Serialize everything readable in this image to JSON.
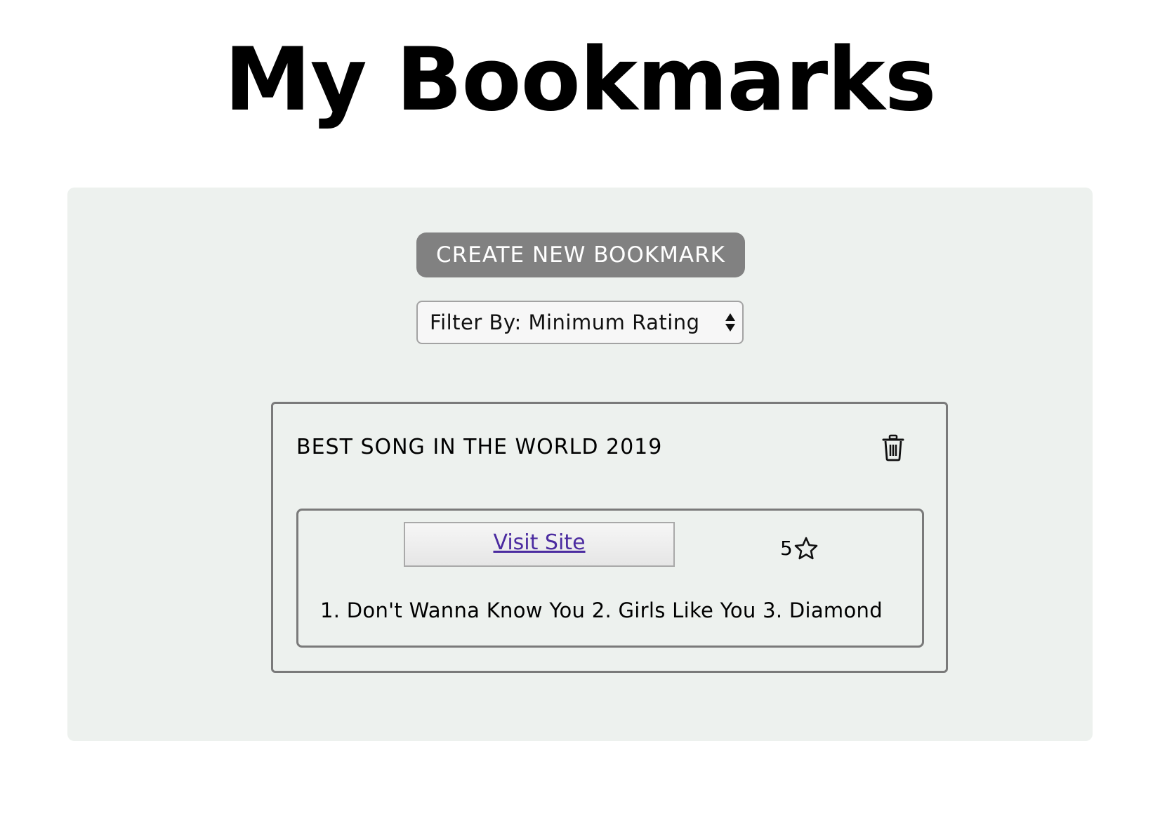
{
  "page": {
    "title": "My Bookmarks"
  },
  "toolbar": {
    "create_label": "CREATE NEW BOOKMARK",
    "filter_label": "Filter By: Minimum Rating"
  },
  "bookmarks": [
    {
      "title": "BEST SONG IN THE WORLD 2019",
      "link_label": "Visit Site",
      "rating": "5",
      "description": "1. Don't Wanna Know You 2. Girls Like You 3. Diamond",
      "icons": {
        "delete": "trash-icon",
        "rating": "star-outline-icon"
      }
    }
  ],
  "colors": {
    "panel_background": "#edf1ee",
    "create_button": "#818181",
    "card_border": "#7a7a7a",
    "link": "#4b2ba0"
  }
}
